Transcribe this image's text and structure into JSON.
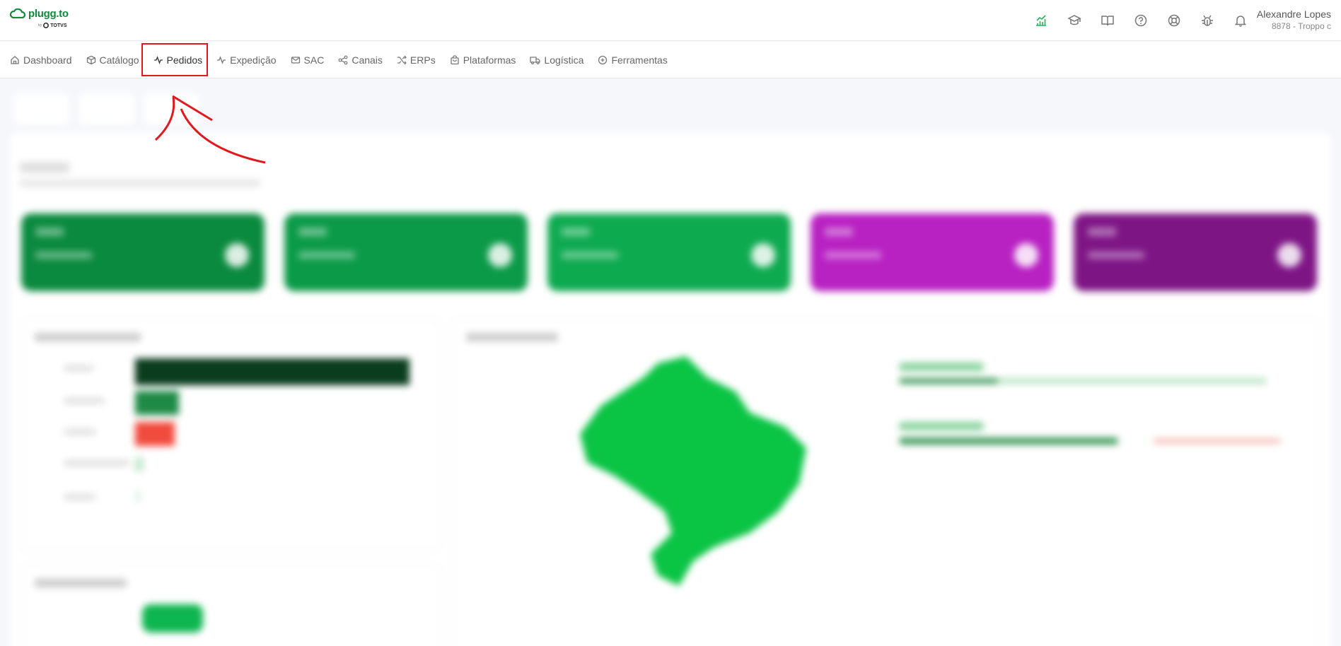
{
  "brand": {
    "name": "plugg.to",
    "by": "by",
    "partner": "TOTVS",
    "green": "#0e8a3c"
  },
  "header": {
    "icons": [
      "chart-up-icon",
      "graduation-cap-icon",
      "book-icon",
      "help-circle-icon",
      "lifebuoy-icon",
      "bug-icon",
      "bell-icon"
    ],
    "user_name": "Alexandre Lopes",
    "user_sub": "8878 - Troppo c"
  },
  "nav": {
    "items": [
      {
        "label": "Dashboard",
        "icon": "home-icon"
      },
      {
        "label": "Catálogo",
        "icon": "cube-icon"
      },
      {
        "label": "Pedidos",
        "icon": "activity-icon",
        "active": true
      },
      {
        "label": "Expedição",
        "icon": "activity-icon"
      },
      {
        "label": "SAC",
        "icon": "mail-icon"
      },
      {
        "label": "Canais",
        "icon": "share-icon"
      },
      {
        "label": "ERPs",
        "icon": "shuffle-icon"
      },
      {
        "label": "Plataformas",
        "icon": "bag-icon"
      },
      {
        "label": "Logística",
        "icon": "truck-icon"
      },
      {
        "label": "Ferramentas",
        "icon": "plus-circle-icon"
      }
    ]
  },
  "annotation": {
    "highlight_color": "#e0191f"
  },
  "colors": {
    "card_dark_green": "#0a8a3e",
    "card_green": "#0b9a48",
    "card_green_light": "#0eaa50",
    "card_magenta": "#b821c2",
    "card_purple": "#7e1585",
    "bar_dark": "#0a3d1e",
    "bar_green": "#1e8a46",
    "bar_red": "#f04b3d",
    "map_green": "#0ac444"
  }
}
